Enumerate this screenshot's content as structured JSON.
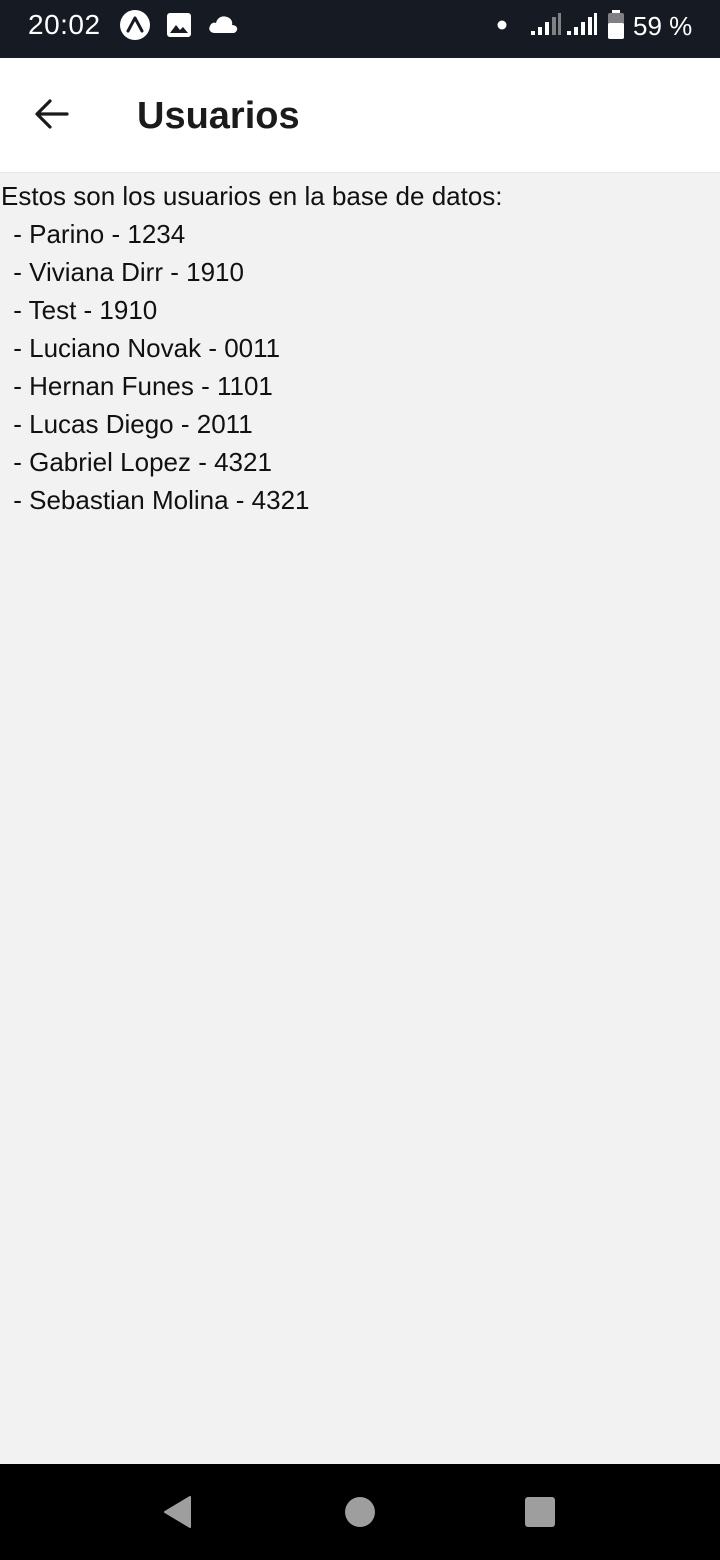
{
  "status_bar": {
    "time": "20:02",
    "icons": [
      "expo-icon",
      "image-icon",
      "cloud-icon",
      "notification-dot-icon",
      "signal-icon",
      "signal-icon",
      "battery-icon"
    ],
    "battery_text": "59 %"
  },
  "header": {
    "back_icon": "arrow-left-icon",
    "title": "Usuarios"
  },
  "content": {
    "intro": "Estos son los usuarios en la base de datos:",
    "users": [
      " - Parino - 1234",
      " - Viviana Dirr - 1910",
      " - Test - 1910",
      " - Luciano Novak - 0011",
      " - Hernan Funes - 1101",
      " - Lucas Diego - 2011",
      " - Gabriel Lopez - 4321",
      " - Sebastian Molina - 4321"
    ]
  },
  "nav_bar": {
    "icons": [
      "nav-back-icon",
      "nav-home-icon",
      "nav-recents-icon"
    ]
  },
  "colors": {
    "status_bar_bg": "#161a22",
    "header_bg": "#ffffff",
    "page_bg": "#f2f2f2",
    "nav_bar_bg": "#000000",
    "nav_icon": "#9e9e9e"
  }
}
